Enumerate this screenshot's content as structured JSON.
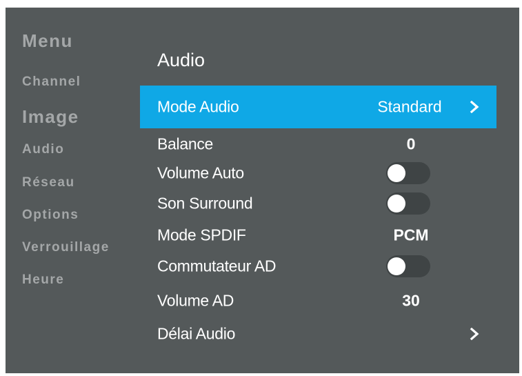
{
  "sidebar": {
    "title": "Menu",
    "items": [
      {
        "label": "Channel"
      },
      {
        "label": "Image"
      },
      {
        "label": "Audio"
      },
      {
        "label": "Réseau"
      },
      {
        "label": "Options"
      },
      {
        "label": "Verrouillage"
      },
      {
        "label": "Heure"
      }
    ]
  },
  "panel": {
    "title": "Audio",
    "items": [
      {
        "label": "Mode Audio",
        "value": "Standard",
        "selected": true,
        "has_arrow": true
      },
      {
        "label": "Balance",
        "value": "0"
      },
      {
        "label": "Volume Auto",
        "toggle": "off"
      },
      {
        "label": "Son Surround",
        "toggle": "off"
      },
      {
        "label": "Mode SPDIF",
        "value": "PCM"
      },
      {
        "label": "Commutateur AD",
        "toggle": "off"
      },
      {
        "label": "Volume AD",
        "value": "30"
      },
      {
        "label": "Délai Audio",
        "has_arrow": true
      }
    ]
  },
  "colors": {
    "background": "#54595a",
    "highlight": "#0fa8e6",
    "sidebar_text": "#a4a7a8",
    "toggle_track": "#3f4445",
    "text": "#ffffff"
  },
  "icons": {
    "arrow": "chevron-right-icon",
    "toggle_knob": "toggle-knob-icon"
  }
}
